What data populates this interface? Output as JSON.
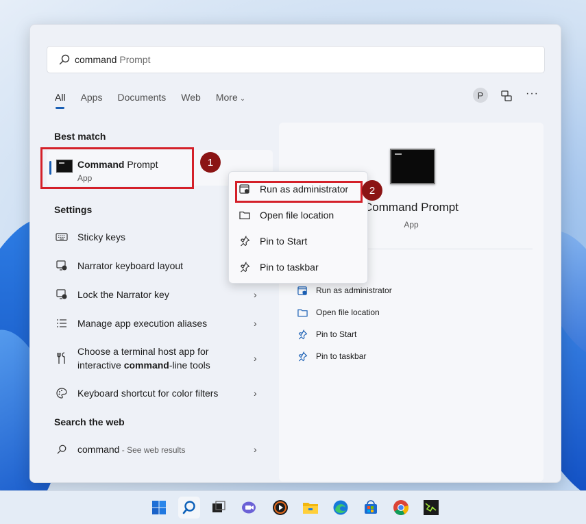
{
  "search": {
    "typed": "command",
    "suggestion": " Prompt"
  },
  "tabs": [
    {
      "label": "All"
    },
    {
      "label": "Apps"
    },
    {
      "label": "Documents"
    },
    {
      "label": "Web"
    },
    {
      "label": "More"
    }
  ],
  "header": {
    "avatar_letter": "P",
    "overflow": "···"
  },
  "best_match": {
    "section_title": "Best match",
    "title_bold": "Command",
    "title_rest": " Prompt",
    "subtitle": "App",
    "badge": "1"
  },
  "settings": {
    "section_title": "Settings",
    "items": [
      {
        "label": "Sticky keys",
        "icon": "keyboard-icon"
      },
      {
        "label": "Narrator keyboard layout",
        "icon": "narrator-icon"
      },
      {
        "label": "Lock the Narrator key",
        "icon": "narrator-icon",
        "arrow": "›"
      },
      {
        "label": "Manage app execution aliases",
        "icon": "list-icon",
        "arrow": "›"
      },
      {
        "label_pre": "Choose a terminal host app for interactive ",
        "label_bold": "command",
        "label_post": "-line tools",
        "icon": "tools-icon",
        "arrow": "›"
      },
      {
        "label": "Keyboard shortcut for color filters",
        "icon": "palette-icon",
        "arrow": "›"
      }
    ]
  },
  "web": {
    "section_title": "Search the web",
    "query": "command",
    "hint": " - See web results",
    "arrow": "›"
  },
  "context_menu": {
    "items": [
      {
        "label": "Run as administrator",
        "icon": "shield-icon"
      },
      {
        "label": "Open file location",
        "icon": "folder-icon"
      },
      {
        "label": "Pin to Start",
        "icon": "pin-icon"
      },
      {
        "label": "Pin to taskbar",
        "icon": "pin-icon"
      }
    ],
    "badge": "2"
  },
  "preview": {
    "title": "Command Prompt",
    "subtitle": "App",
    "actions": [
      {
        "label": "Run as administrator",
        "icon": "shield-icon"
      },
      {
        "label": "Open file location",
        "icon": "folder-icon"
      },
      {
        "label": "Pin to Start",
        "icon": "pin-icon"
      },
      {
        "label": "Pin to taskbar",
        "icon": "pin-icon"
      }
    ]
  },
  "taskbar": {
    "icons": [
      "windows-start-icon",
      "search-icon",
      "task-view-icon",
      "chat-icon",
      "media-player-icon",
      "file-explorer-icon",
      "edge-icon",
      "store-icon",
      "chrome-icon",
      "app-icon"
    ]
  },
  "colors": {
    "accent": "#1a5fb4",
    "highlight_red": "#d42029",
    "badge": "#8b1414"
  }
}
